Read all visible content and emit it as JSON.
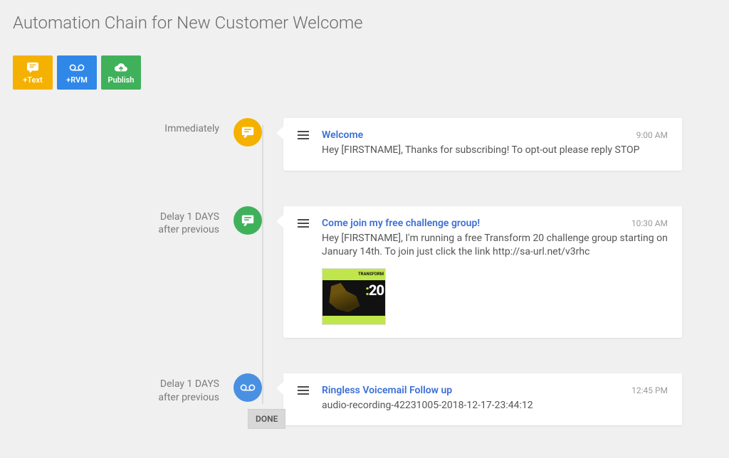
{
  "page": {
    "title": "Automation Chain for New Customer Welcome"
  },
  "toolbar": {
    "text_label": "+Text",
    "rvm_label": "+RVM",
    "publish_label": "Publish"
  },
  "steps": [
    {
      "delay_label": "Immediately",
      "delay_sub": "",
      "node_color": "yellow",
      "node_icon": "message",
      "title": "Welcome",
      "time": "9:00 AM",
      "body": "Hey [FIRSTNAME], Thanks for subscribing! To opt-out please reply STOP"
    },
    {
      "delay_label": "Delay 1 DAYS",
      "delay_sub": "after previous",
      "node_color": "green",
      "node_icon": "message",
      "title": "Come join my free challenge group!",
      "time": "10:30 AM",
      "body": "Hey [FIRSTNAME], I'm running a free Transform 20 challenge group starting on January 14th. To join just click the link http://sa-url.net/v3rhc",
      "attachment": {
        "label_top": "TRANSFORM",
        "big": "20",
        "label_bot": ""
      }
    },
    {
      "delay_label": "Delay 1 DAYS",
      "delay_sub": "after previous",
      "node_color": "blue",
      "node_icon": "voicemail",
      "title": "Ringless Voicemail Follow up",
      "time": "12:45 PM",
      "body": "audio-recording-42231005-2018-12-17-23:44:12"
    }
  ],
  "done_label": "DONE"
}
